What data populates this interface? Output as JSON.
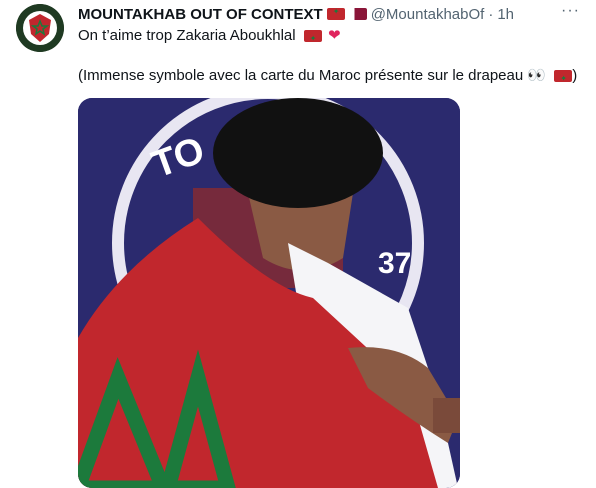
{
  "tweet": {
    "account_name": "MOUNTAKHAB OUT OF CONTEXT",
    "handle": "@MountakhabOf",
    "time": "1h",
    "more_icon": "more-horizontal-icon",
    "text_line1": "On t’aime trop Zakaria Aboukhlal",
    "text_line2": "(Immense symbole avec la carte du Maroc présente sur le drapeau",
    "eyes": "👀",
    "heart": "❤",
    "media_badge": "37",
    "media_logo_text": "TO"
  },
  "colors": {
    "flag_red": "#c1272d",
    "flag_green": "#1c7a3c",
    "qatar_maroon": "#8a1538",
    "media_bg": "#2b2a6e"
  }
}
